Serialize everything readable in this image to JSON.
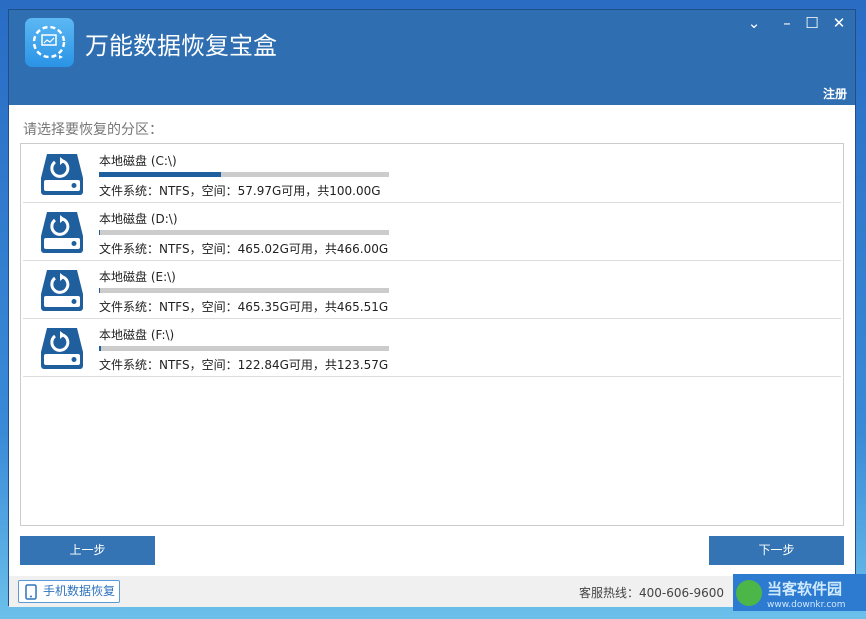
{
  "app": {
    "title": "万能数据恢复宝盒",
    "register": "注册"
  },
  "window_controls": [
    "chevron-down",
    "minimize",
    "maximize",
    "close"
  ],
  "prompt": "请选择要恢复的分区：",
  "partitions": [
    {
      "name": "本地磁盘 (C:\\)",
      "info": "文件系统：NTFS，空间：57.97G可用，共100.00G",
      "used_fraction": 0.42
    },
    {
      "name": "本地磁盘 (D:\\)",
      "info": "文件系统：NTFS，空间：465.02G可用，共466.00G",
      "used_fraction": 0.002
    },
    {
      "name": "本地磁盘 (E:\\)",
      "info": "文件系统：NTFS，空间：465.35G可用，共465.51G",
      "used_fraction": 0.0003
    },
    {
      "name": "本地磁盘 (F:\\)",
      "info": "文件系统：NTFS，空间：122.84G可用，共123.57G",
      "used_fraction": 0.006
    }
  ],
  "buttons": {
    "prev": "上一步",
    "next": "下一步"
  },
  "footer": {
    "mobile": "手机数据恢复",
    "hotline": "客服热线：400-606-9600"
  },
  "watermark": {
    "name": "当客软件园",
    "url": "www.downkr.com"
  },
  "colors": {
    "titlebar": "#2f6fb1",
    "button": "#3574b4",
    "progress": "#1f5f9e"
  }
}
